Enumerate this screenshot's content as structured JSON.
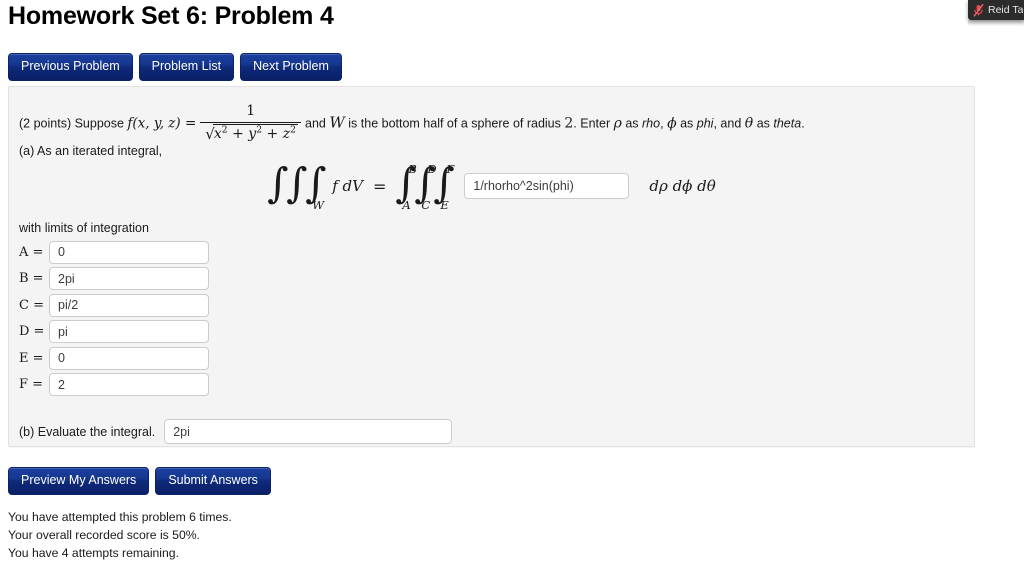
{
  "page": {
    "title": "Homework Set 6: Problem 4"
  },
  "nav": {
    "previous_label": "Previous Problem",
    "problem_list_label": "Problem List",
    "next_label": "Next Problem"
  },
  "problem": {
    "points_prefix": "(2 points) Suppose",
    "function_name": "f(x, y, z) =",
    "fraction_numerator": "1",
    "fraction_denominator": "x² + y² + z²",
    "middle_text": "and",
    "region_symbol": "W",
    "tail_text_1": "is the bottom half of a sphere of radius",
    "radius": "2",
    "tail_text_2": ". Enter",
    "rho_symbol": "ρ",
    "rho_as": "as",
    "rho_word": "rho",
    "phi_symbol": "ϕ",
    "phi_as": "as",
    "phi_word": "phi",
    "and_word": ", and",
    "theta_symbol": "θ",
    "theta_as": "as",
    "theta_word": "theta",
    "period": "."
  },
  "part_a": {
    "label": "(a) As an iterated integral,",
    "equation": {
      "lhs_integrand": "f dV",
      "lhs_subscript": "W",
      "equals": "=",
      "limits": [
        {
          "lower": "A",
          "upper": "B"
        },
        {
          "lower": "C",
          "upper": "D"
        },
        {
          "lower": "E",
          "upper": "F"
        }
      ],
      "differentials": "dρ dϕ dθ"
    },
    "integrand_value": "1/rhorho^2sin(phi)",
    "integrand_placeholder": "",
    "limits_label": "with limits of integration",
    "limit_fields": [
      {
        "name": "A =",
        "value": "0"
      },
      {
        "name": "B =",
        "value": "2pi"
      },
      {
        "name": "C =",
        "value": "pi/2"
      },
      {
        "name": "D =",
        "value": "pi"
      },
      {
        "name": "E =",
        "value": "0"
      },
      {
        "name": "F =",
        "value": "2"
      }
    ]
  },
  "part_b": {
    "label": "(b) Evaluate the integral.",
    "value": "2pi",
    "placeholder": ""
  },
  "actions": {
    "preview_label": "Preview My Answers",
    "submit_label": "Submit Answers"
  },
  "status": {
    "attempts": "You have attempted this problem 6 times.",
    "score": "Your overall recorded score is 50%.",
    "remaining": "You have 4 attempts remaining."
  },
  "overlay": {
    "participant_name": "Reid Ta",
    "mic_state": "microphone-muted"
  },
  "colors": {
    "button_blue_top": "#1b3fa0",
    "button_blue_bottom": "#0a1f66",
    "panel_background": "#f4f4f4",
    "panel_border": "#e2e2e2",
    "input_border": "#cccccc",
    "mic_muted_red": "#e84b4b",
    "overlay_background": "#2c2c2c"
  }
}
